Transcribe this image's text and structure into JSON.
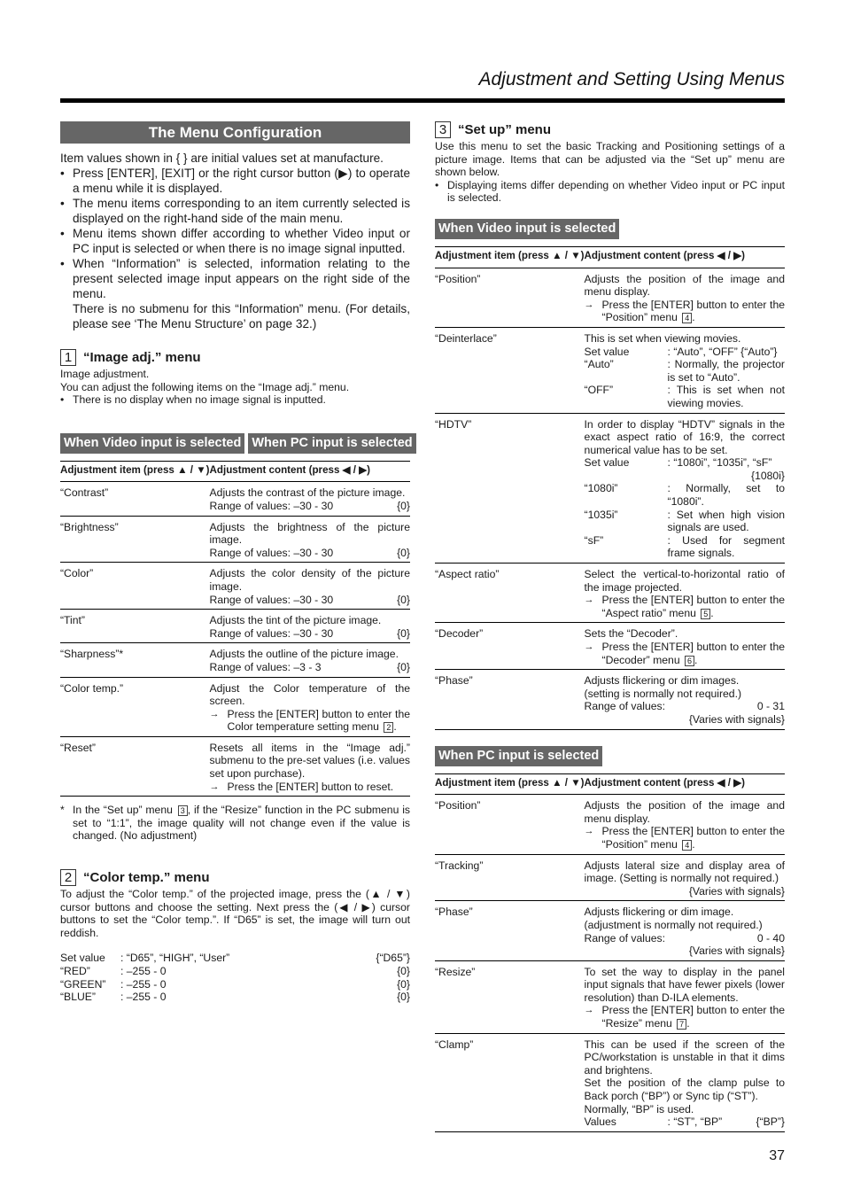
{
  "header": {
    "title": "Adjustment and Setting Using Menus"
  },
  "left": {
    "banner": "The Menu Configuration",
    "intro": "Item values shown in {  } are initial values set at manufacture.",
    "bullets": [
      "Press [ENTER], [EXIT] or the right cursor button (▶) to operate a menu while it is displayed.",
      "The menu items corresponding to an item currently selected is displayed on the right-hand side of the main menu.",
      "Menu items shown differ according to whether Video input or PC input is selected or when there is no image signal inputted.",
      "When “Information” is selected, information relating to the present selected image input appears on the right side of the menu."
    ],
    "bullet_extra": "There is no submenu for this “Information” menu. (For details, please see ‘The Menu Structure’ on page 32.)",
    "image_adj": {
      "number": "1",
      "title": "“Image adj.” menu",
      "lines": [
        "Image adjustment.",
        "You can adjust the following items on the “Image adj.” menu."
      ],
      "bullet": "There is no display when no image signal is inputted.",
      "tabs": [
        "When Video input is selected",
        "When PC input is selected"
      ],
      "col_headers": [
        "Adjustment item (press ▲ / ▼)",
        "Adjustment content (press ◀ / ▶)"
      ],
      "rows": [
        {
          "item": "“Contrast”",
          "desc": "Adjusts the contrast of the picture image.",
          "range": "Range of values: –30 - 30",
          "default": "{0}"
        },
        {
          "item": "“Brightness”",
          "desc": "Adjusts the brightness of the picture image.",
          "range": "Range of values: –30 - 30",
          "default": "{0}"
        },
        {
          "item": "“Color”",
          "desc": "Adjusts the color density of the picture image.",
          "range": "Range of values: –30 - 30",
          "default": "{0}"
        },
        {
          "item": "“Tint”",
          "desc": "Adjusts the tint of the picture image.",
          "range": "Range of values: –30 - 30",
          "default": "{0}"
        },
        {
          "item": "“Sharpness”*",
          "desc": "Adjusts the outline of the picture image.",
          "range": "Range of values: –3 - 3",
          "default": "{0}"
        }
      ],
      "color_temp_row": {
        "item": "“Color temp.”",
        "desc": "Adjust the Color temperature of the screen.",
        "arrow": "Press the [ENTER] button to enter the Color temperature setting menu",
        "ref": "2"
      },
      "reset_row": {
        "item": "“Reset”",
        "desc": "Resets all items in the “Image adj.” submenu to the pre-set values (i.e. values set upon purchase).",
        "arrow": "Press the [ENTER] button to reset."
      },
      "footnote_pre": "In the “Set up” menu",
      "footnote_ref": "3",
      "footnote_post": ", if the “Resize” function in the PC submenu is set to “1:1”, the image quality will not change even if the value is changed. (No adjustment)"
    },
    "color_temp": {
      "number": "2",
      "title": "“Color temp.” menu",
      "text": "To adjust the “Color temp.” of the projected image, press the (▲ / ▼) cursor buttons and choose the setting. Next press the (◀ / ▶) cursor buttons to set the “Color temp.”. If “D65” is set, the image will turn out reddish.",
      "settings": [
        {
          "key": "Set value",
          "value": ": “D65”, “HIGH”, “User”",
          "default": "{“D65”}"
        },
        {
          "key": "“RED”",
          "value": ": –255 - 0",
          "default": "{0}"
        },
        {
          "key": "“GREEN”",
          "value": ": –255 - 0",
          "default": "{0}"
        },
        {
          "key": "“BLUE”",
          "value": ": –255 - 0",
          "default": "{0}"
        }
      ]
    }
  },
  "right": {
    "setup": {
      "number": "3",
      "title": "“Set up” menu",
      "text": "Use this menu to set the basic Tracking and Positioning settings of a picture image. Items that can be adjusted via the “Set up” menu are shown below.",
      "bullet": "Displaying items differ depending on whether Video input or PC input is selected."
    },
    "video": {
      "tab": "When Video input is selected",
      "col_headers": [
        "Adjustment item (press ▲ / ▼)",
        "Adjustment content (press ◀ / ▶)"
      ],
      "position": {
        "item": "“Position”",
        "desc": "Adjusts the position of the image and menu display.",
        "arrow": "Press the [ENTER] button to enter the “Position” menu",
        "ref": "4"
      },
      "deinterlace": {
        "item": "“Deinterlace”",
        "desc": "This is set when viewing movies.",
        "kv": [
          {
            "k": "Set value",
            "v": ": “Auto”, “OFF”   {“Auto”}"
          },
          {
            "k": "“Auto”",
            "v": ": Normally, the projector is set to “Auto”."
          },
          {
            "k": "“OFF”",
            "v": ": This is set when not viewing movies."
          }
        ]
      },
      "hdtv": {
        "item": "“HDTV”",
        "desc": "In order to display “HDTV” signals in the exact aspect ratio of 16:9, the correct numerical value has to be set.",
        "kv": [
          {
            "k": "Set value",
            "v": ": “1080i”, “1035i”, “sF”"
          },
          {
            "k": "",
            "v": "{1080i}"
          },
          {
            "k": "“1080i”",
            "v": ": Normally, set to “1080i”."
          },
          {
            "k": "“1035i”",
            "v": ": Set when high vision signals are used."
          },
          {
            "k": "“sF”",
            "v": ": Used for segment frame signals."
          }
        ]
      },
      "aspect": {
        "item": "“Aspect ratio”",
        "desc": "Select the vertical-to-horizontal ratio of the image projected.",
        "arrow": "Press the [ENTER] button to enter the “Aspect ratio” menu",
        "ref": "5"
      },
      "decoder": {
        "item": "“Decoder”",
        "desc": "Sets the “Decoder”.",
        "arrow": "Press the [ENTER] button to enter the “Decoder” menu",
        "ref": "6"
      },
      "phase": {
        "item": "“Phase”",
        "desc1": "Adjusts flickering or dim images.",
        "desc2": "(setting is normally not required.)",
        "range_label": "Range of values:",
        "range": "0 - 31",
        "default": "{Varies with signals}"
      }
    },
    "pc": {
      "tab": "When PC input is selected",
      "col_headers": [
        "Adjustment item (press ▲ / ▼)",
        "Adjustment content (press ◀ / ▶)"
      ],
      "position": {
        "item": "“Position”",
        "desc": "Adjusts the position of the image and menu display.",
        "arrow": "Press the [ENTER] button to enter the “Position” menu",
        "ref": "4"
      },
      "tracking": {
        "item": "“Tracking”",
        "desc": "Adjusts lateral size and display area of image. (Setting is normally not required.)",
        "default": "{Varies with signals}"
      },
      "phase": {
        "item": "“Phase”",
        "desc1": "Adjusts flickering or dim image.",
        "desc2": "(adjustment is normally not required.)",
        "range_label": "Range of values:",
        "range": "0 - 40",
        "default": "{Varies with signals}"
      },
      "resize": {
        "item": "“Resize”",
        "desc": "To set the way to display in the panel input signals that have fewer pixels (lower resolution) than D-ILA elements.",
        "arrow": "Press the [ENTER] button to enter the “Resize” menu",
        "ref": "7"
      },
      "clamp": {
        "item": "“Clamp”",
        "desc1": "This can be used if the screen of the PC/workstation is unstable in that it dims and brightens.",
        "desc2": "Set the position of the clamp pulse to Back porch (“BP”) or Sync tip (“ST”).",
        "desc3": "Normally, “BP” is used.",
        "values_label": "Values",
        "values": ": “ST”, “BP”",
        "default": "{“BP”}"
      }
    }
  },
  "footer": {
    "page_number": "37"
  },
  "icons": {
    "arrow": "→"
  }
}
